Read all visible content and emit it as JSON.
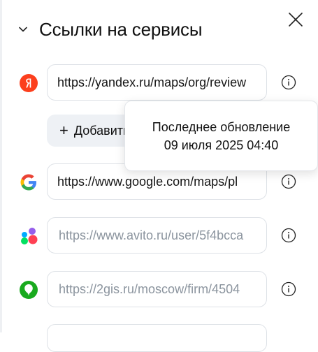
{
  "header": {
    "title": "Ссылки на сервисы"
  },
  "services": [
    {
      "name": "yandex",
      "icon": "yandex-icon",
      "value": "https://yandex.ru/maps/org/review",
      "placeholder": ""
    },
    {
      "name": "google",
      "icon": "google-icon",
      "value": "https://www.google.com/maps/pl",
      "placeholder": ""
    },
    {
      "name": "avito",
      "icon": "avito-icon",
      "value": "",
      "placeholder": "https://www.avito.ru/user/5f4bcca"
    },
    {
      "name": "2gis",
      "icon": "2gis-icon",
      "value": "",
      "placeholder": "https://2gis.ru/moscow/firm/4504"
    }
  ],
  "add_button": {
    "label": "Добавить"
  },
  "tooltip": {
    "line1": "Последнее обновление",
    "line2": "09 июля 2025 04:40"
  },
  "colors": {
    "yandex_red": "#fc3f1d",
    "twogis_green": "#19aa1e",
    "placeholder": "#8b949e",
    "border": "#dde1e6",
    "button_bg": "#eef1f5"
  }
}
